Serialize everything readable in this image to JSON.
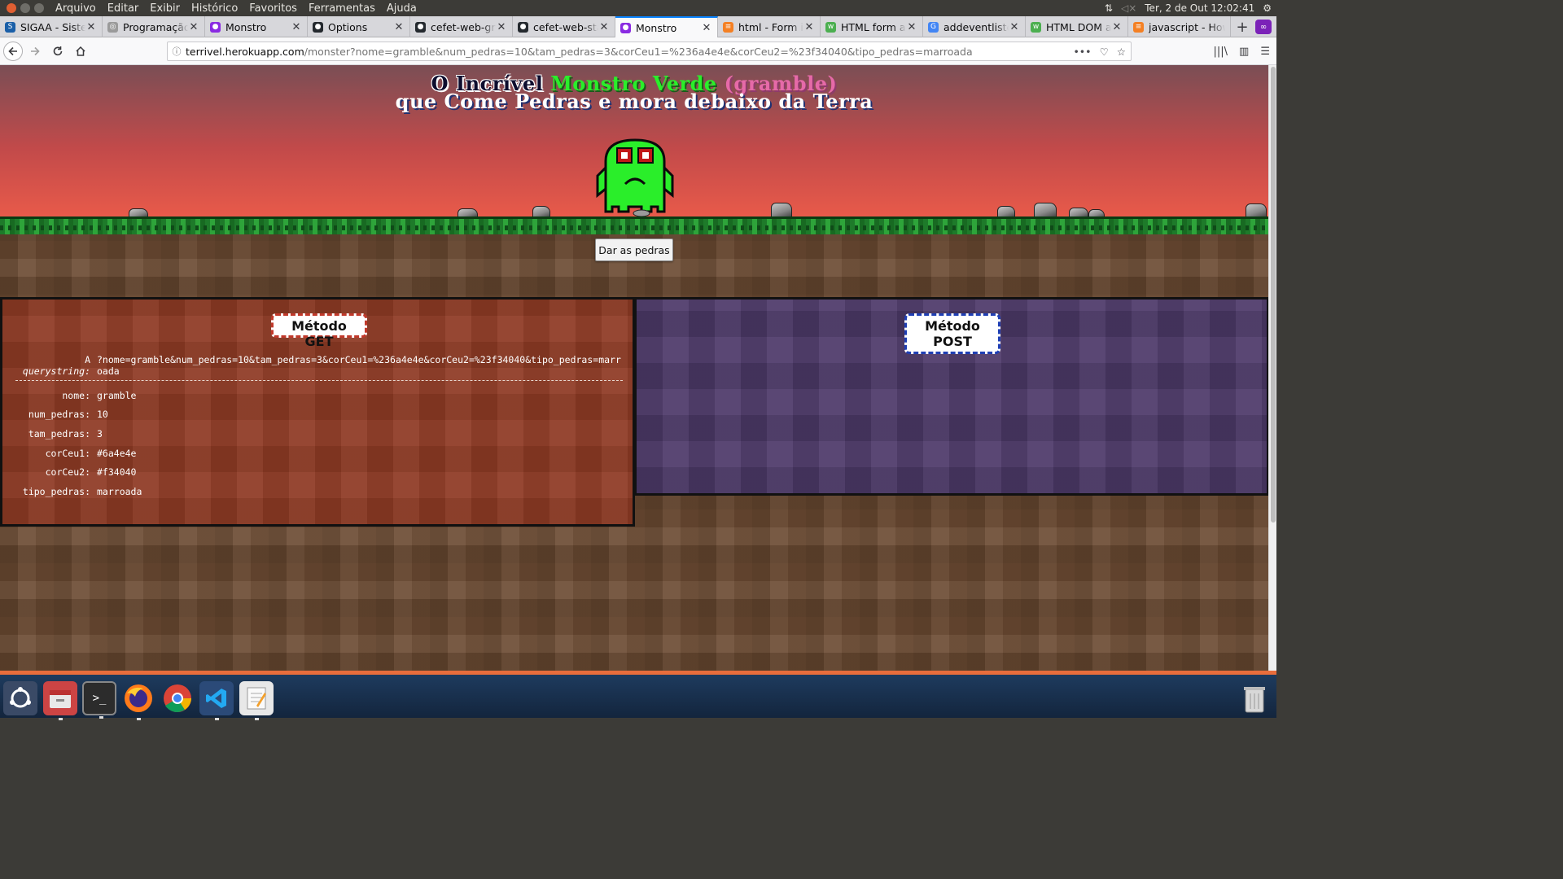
{
  "system": {
    "menu": [
      "Arquivo",
      "Editar",
      "Exibir",
      "Histórico",
      "Favoritos",
      "Ferramentas",
      "Ajuda"
    ],
    "clock": "Ter, 2 de Out 12:02:41"
  },
  "tabs": [
    {
      "label": "SIGAA - Sistema",
      "icon": "sigaa-icon",
      "color": "#1a5fa8"
    },
    {
      "label": "Programação",
      "icon": "globe-icon",
      "color": "#888888"
    },
    {
      "label": "Monstro",
      "icon": "monster-icon",
      "color": "#8a2be2"
    },
    {
      "label": "Options",
      "icon": "github-icon",
      "color": "#24292e"
    },
    {
      "label": "cefet-web-grameble",
      "icon": "github-icon",
      "color": "#24292e"
    },
    {
      "label": "cefet-web-starter",
      "icon": "github-icon",
      "color": "#24292e"
    },
    {
      "label": "Monstro",
      "icon": "monster-icon",
      "color": "#8a2be2",
      "active": true
    },
    {
      "label": "html - Form is",
      "icon": "stackoverflow-icon",
      "color": "#f48024"
    },
    {
      "label": "HTML form ac",
      "icon": "w3schools-icon",
      "color": "#4caf50"
    },
    {
      "label": "addeventlistener",
      "icon": "google-icon",
      "color": "#4285f4"
    },
    {
      "label": "HTML DOM a",
      "icon": "w3schools-icon",
      "color": "#4caf50"
    },
    {
      "label": "javascript - How",
      "icon": "stackoverflow-icon",
      "color": "#f48024"
    }
  ],
  "url": {
    "host": "terrivel.herokuapp.com",
    "path": "/monster?nome=gramble&num_pedras=10&tam_pedras=3&corCeu1=%236a4e4e&corCeu2=%23f34040&tipo_pedras=marroada"
  },
  "page": {
    "title_part1": "O Incrível",
    "title_part2": "Monstro Verde",
    "title_part3": "(gramble)",
    "title_line2": "que Come Pedras e mora debaixo da Terra",
    "button_label": "Dar as pedras",
    "get_title": "Método GET",
    "post_title_1": "Método",
    "post_title_2": "POST",
    "qs_label_1": "A",
    "qs_label_2": "querystring:",
    "qs_value": "?nome=gramble&num_pedras=10&tam_pedras=3&corCeu1=%236a4e4e&corCeu2=%23f34040&tipo_pedras=marroada",
    "params": [
      {
        "key": "nome:",
        "value": "gramble"
      },
      {
        "key": "num_pedras:",
        "value": "10"
      },
      {
        "key": "tam_pedras:",
        "value": "3"
      },
      {
        "key": "corCeu1:",
        "value": "#6a4e4e"
      },
      {
        "key": "corCeu2:",
        "value": "#f34040"
      },
      {
        "key": "tipo_pedras:",
        "value": "marroada"
      }
    ]
  },
  "colors": {
    "sky_top": "#6a4e4e",
    "sky_bottom": "#f34040",
    "monster": "#2aee2a",
    "get_panel": "#8e3a24",
    "post_panel": "#4e3a6a"
  }
}
